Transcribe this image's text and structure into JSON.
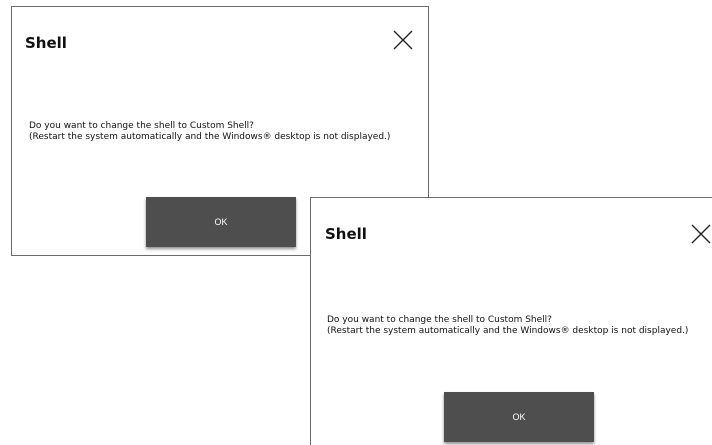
{
  "dialogs": [
    {
      "title": "Shell",
      "message_line1": "Do you want to change the shell to Custom Shell?",
      "message_line2": "(Restart the system automatically and the Windows® desktop is not displayed.)",
      "ok_label": "OK"
    },
    {
      "title": "Shell",
      "message_line1": "Do you want to change the shell to Custom Shell?",
      "message_line2": "(Restart the system automatically and the Windows® desktop is not displayed.)",
      "ok_label": "OK"
    }
  ],
  "icons": {
    "close": "close-icon"
  },
  "colors": {
    "ok_button_bg": "#4e4e4e",
    "ok_button_text": "#ffffff",
    "dialog_border": "#6b6b6b"
  }
}
